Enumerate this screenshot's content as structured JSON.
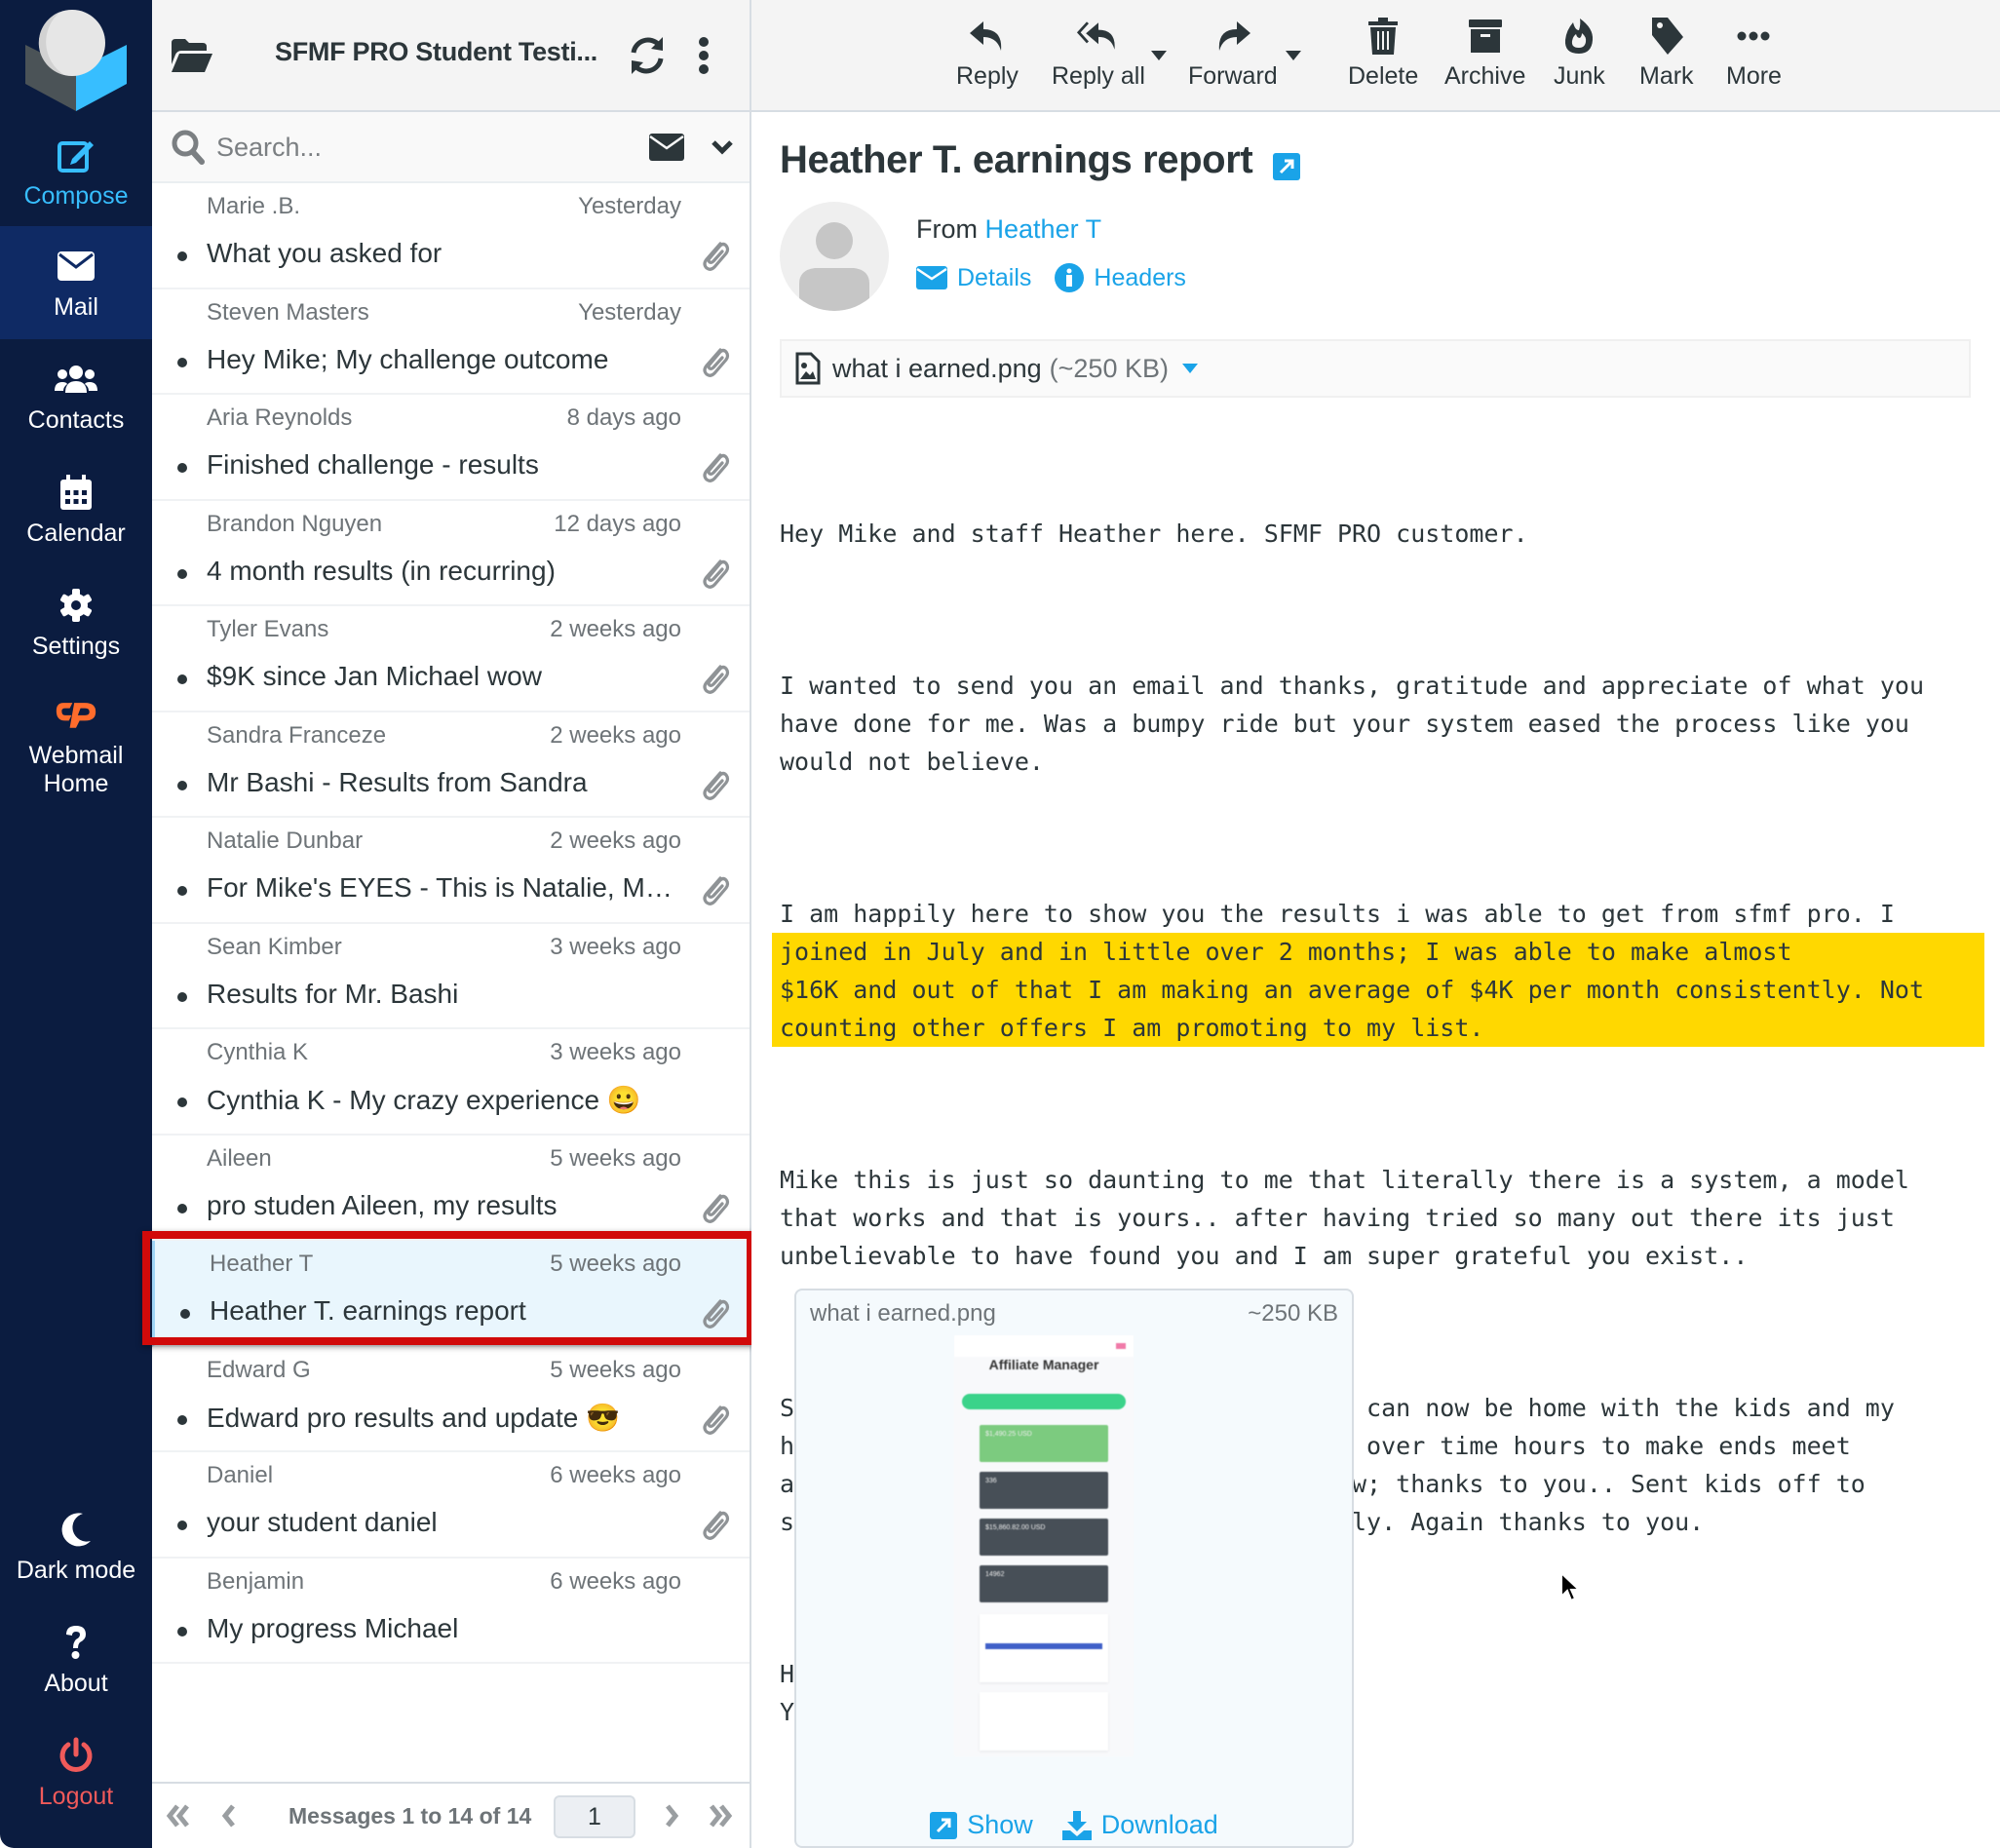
{
  "nav": {
    "items": [
      {
        "label": "Compose",
        "icon": "compose-icon"
      },
      {
        "label": "Mail",
        "icon": "envelope-icon"
      },
      {
        "label": "Contacts",
        "icon": "users-icon"
      },
      {
        "label": "Calendar",
        "icon": "calendar-icon"
      },
      {
        "label": "Settings",
        "icon": "gear-icon"
      },
      {
        "label": "Webmail Home",
        "icon": "cpanel-icon"
      }
    ],
    "bottom": [
      {
        "label": "Dark mode",
        "icon": "moon-icon"
      },
      {
        "label": "About",
        "icon": "question-icon"
      },
      {
        "label": "Logout",
        "icon": "power-icon"
      }
    ],
    "active": "Mail",
    "colors": {
      "background": "#0b1c40",
      "active": "#0f2a64",
      "compose": "#37beff",
      "logout": "#f05a5a"
    }
  },
  "list": {
    "folder_title": "SFMF PRO Student Testi...",
    "search": {
      "placeholder": "Search...",
      "value": ""
    },
    "messages": [
      {
        "from": "Marie .B.",
        "date": "Yesterday",
        "subject": "What you asked for",
        "attachment": true
      },
      {
        "from": "Steven Masters",
        "date": "Yesterday",
        "subject": "Hey Mike; My challenge outcome",
        "attachment": true
      },
      {
        "from": "Aria Reynolds",
        "date": "8 days ago",
        "subject": "Finished challenge - results",
        "attachment": true
      },
      {
        "from": "Brandon Nguyen",
        "date": "12 days ago",
        "subject": "4 month results (in recurring)",
        "attachment": true
      },
      {
        "from": "Tyler Evans",
        "date": "2 weeks ago",
        "subject": "$9K since Jan Michael wow",
        "attachment": true
      },
      {
        "from": "Sandra Franceze",
        "date": "2 weeks ago",
        "subject": "Mr Bashi - Results from Sandra",
        "attachment": true
      },
      {
        "from": "Natalie Dunbar",
        "date": "2 weeks ago",
        "subject": "For Mike's EYES - This is Natalie, My ...",
        "attachment": true
      },
      {
        "from": "Sean Kimber",
        "date": "3 weeks ago",
        "subject": "Results for Mr. Bashi",
        "attachment": false
      },
      {
        "from": "Cynthia K",
        "date": "3 weeks ago",
        "subject": "Cynthia K - My crazy experience 😀",
        "attachment": false
      },
      {
        "from": "Aileen",
        "date": "5 weeks ago",
        "subject": "pro studen Aileen, my results",
        "attachment": true
      },
      {
        "from": "Heather T",
        "date": "5 weeks ago",
        "subject": "Heather T. earnings report",
        "attachment": true,
        "selected": true
      },
      {
        "from": "Edward G",
        "date": "5 weeks ago",
        "subject": "Edward pro results and update 😎",
        "attachment": true
      },
      {
        "from": "Daniel",
        "date": "6 weeks ago",
        "subject": "your student daniel",
        "attachment": true
      },
      {
        "from": "Benjamin",
        "date": "6 weeks ago",
        "subject": "My progress Michael",
        "attachment": false
      }
    ],
    "pager": {
      "count_text": "Messages 1 to 14 of 14",
      "page": "1"
    }
  },
  "toolbar": {
    "buttons": [
      {
        "label": "Reply",
        "icon": "reply-icon"
      },
      {
        "label": "Reply all",
        "icon": "reply-all-icon"
      },
      {
        "label": "Forward",
        "icon": "forward-icon"
      },
      {
        "label": "Delete",
        "icon": "trash-icon"
      },
      {
        "label": "Archive",
        "icon": "archive-icon"
      },
      {
        "label": "Junk",
        "icon": "fire-icon"
      },
      {
        "label": "Mark",
        "icon": "tag-icon"
      },
      {
        "label": "More",
        "icon": "more-icon"
      }
    ]
  },
  "message": {
    "subject": "Heather T. earnings report",
    "from_label": "From",
    "from_name": "Heather T",
    "details_label": "Details",
    "headers_label": "Headers",
    "attachment": {
      "name": "what i earned.png",
      "size": "(~250 KB)",
      "size_short": "~250 KB"
    },
    "body": {
      "p1": "Hey Mike and staff Heather here. SFMF PRO customer.",
      "p2": "I wanted to send you an email and thanks, gratitude and appreciate of what you\nhave done for me. Was a bumpy ride but your system eased the process like you\nwould not believe.",
      "p3_plain": "I am happily here to show you the results i was able to get from sfmf pro. I",
      "p3_highlight": "joined in July and in little over 2 months; I was able to make almost\n$16K and out of that I am making an average of $4K per month consistently. Not\ncounting other offers I am promoting to my list.",
      "p4": "Mike this is just so daunting to me that literally there is a system, a model\nthat works and that is yours.. after having tried so many out there its just\nunbelievable to have found you and I am super grateful you exist..",
      "p5": "Stay blessed Michael, you deserve it. I can now be home with the kids and my\nhusband does not have to work all these over time hours to make ends meet\nanymore. We can actually be a family now; thanks to you.. Sent kids off to\nschool this year all together as a family. Again thanks to you.",
      "signature": "Heather Talatalia\nYour loyal SFMF PRO STUDENT FOR LIFE"
    },
    "highlight_color": "#ffd800",
    "link_color": "#1aa3e8",
    "preview": {
      "title": "Affiliate Manager",
      "cards": [
        "$1,490.25 USD",
        "336",
        "$15,860.82.00 USD",
        "14962"
      ],
      "show_label": "Show",
      "download_label": "Download"
    }
  }
}
